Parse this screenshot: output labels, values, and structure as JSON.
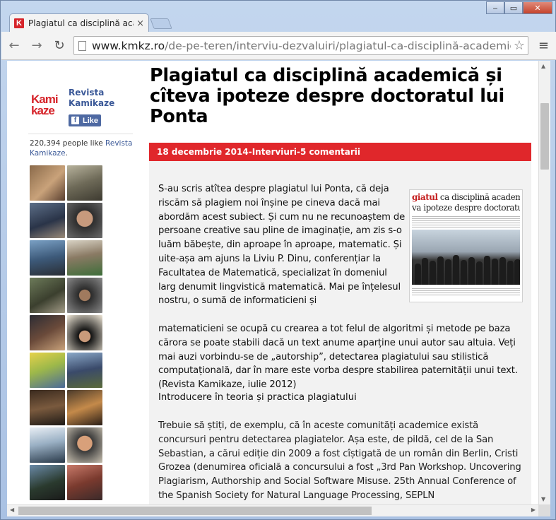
{
  "browser": {
    "tab_title": "Plagiatul ca disciplină academică",
    "tab_favicon_letter": "K",
    "url_host": "www.kmkz.ro",
    "url_path": "/de-pe-teren/interviu-dezvaluiri/plagiatul-ca-disciplină-academică-și-cîte",
    "close_glyph": "×",
    "back_glyph": "←",
    "forward_glyph": "→",
    "reload_glyph": "↻",
    "star_glyph": "☆",
    "menu_glyph": "≡",
    "min_glyph": "‒",
    "max_glyph": "▭",
    "winclose_glyph": "✕"
  },
  "sidebar": {
    "logo_line1": "Kami",
    "logo_line2": "kaze",
    "page_name": "Revista Kamikaze",
    "like_label": "Like",
    "like_f": "f",
    "likes_count": "220,394 people like",
    "likes_link": "Revista Kamikaze",
    "likes_tail": "."
  },
  "article": {
    "title": "Plagiatul ca disciplină academică și cîteva ipoteze despre doctoratul lui Ponta",
    "date": "18 decembrie 2014",
    "separator": "-",
    "category": "Interviuri",
    "comments": "5 comentarii",
    "figure_title_red": "giatul",
    "figure_title_rest": " ca disciplină academică",
    "figure_subtitle": "va ipoteze despre doctoratul lui Po",
    "paragraph1a": "S-au scris atîtea despre plagiatul lui Ponta, că deja riscăm să plagiem noi înșine pe cineva dacă mai abordăm acest subiect. Și cum nu ne recunoaștem de persoane creative sau pline de imaginație, am zis s-o luăm băbește, din aproape în aproape, matematic. Și uite-așa am ajuns la Liviu P. Dinu, conferențiar la Facultatea de Matematică, specializat în domeniul larg denumit lingvistică matematică. Mai pe înțelesul nostru, o sumă de informaticieni și",
    "paragraph1b": "matematicieni se ocupă cu crearea a tot felul de algoritmi și metode pe baza cărora se poate stabili dacă un text anume aparține unui autor sau altuia. Veți mai auzi vorbindu-se de „autorship”, detectarea plagiatului sau stilistică computațională, dar în mare este vorba despre stabilirea paternității unui text. (Revista Kamikaze, iulie 2012)",
    "heading2": "Introducere în teoria și practica plagiatului",
    "paragraph2": "Trebuie să știți, de exemplu, că în aceste comunități academice există concursuri pentru detectarea plagiatelor. Așa este, de pildă, cel de la San Sebastian, a cărui ediție din 2009 a fost cîștigată de un român din Berlin, Cristi Grozea (denumirea oficială a concursului a fost „3rd Pan Workshop. Uncovering Plagiarism, Authorship and Social Software Misuse. 25th Annual Conference of the Spanish Society for Natural Language Processing, SEPLN"
  },
  "colors": {
    "accent_red": "#e0272b",
    "facebook_blue": "#3b5998"
  }
}
